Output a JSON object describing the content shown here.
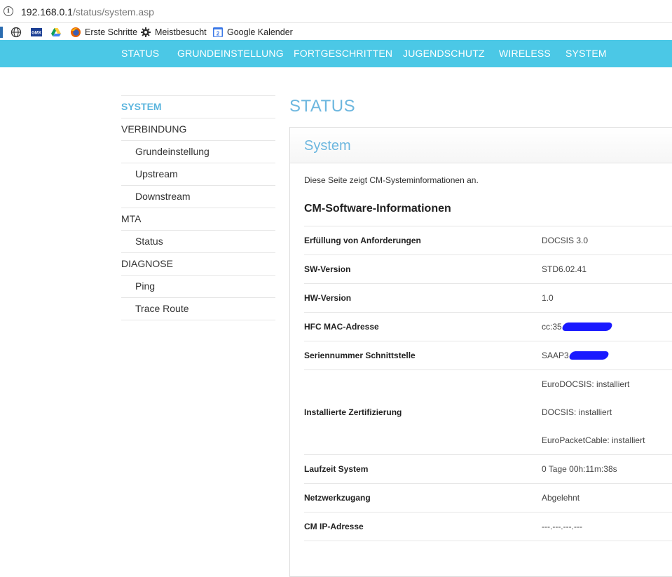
{
  "browser": {
    "url_host": "192.168.0.1",
    "url_path": "/status/system.asp",
    "bookmarks": [
      {
        "label": "",
        "icon": "globe-icon"
      },
      {
        "label": "",
        "icon": "gmx-icon"
      },
      {
        "label": "",
        "icon": "google-drive-icon"
      },
      {
        "label": "Erste Schritte",
        "icon": "firefox-icon"
      },
      {
        "label": "Meistbesucht",
        "icon": "gear-icon"
      },
      {
        "label": "Google Kalender",
        "icon": "calendar-icon",
        "icon_text": "2"
      }
    ]
  },
  "topnav": {
    "items": [
      "STATUS",
      "GRUNDEINSTELLUNG",
      "FORTGESCHRITTEN",
      "JUGENDSCHUTZ",
      "WIRELESS",
      "SYSTEM"
    ],
    "color": "#4bc8e6"
  },
  "sidebar": {
    "items": [
      {
        "label": "SYSTEM",
        "active": true
      },
      {
        "label": "VERBINDUNG"
      },
      {
        "label": "Grundeinstellung"
      },
      {
        "label": "Upstream"
      },
      {
        "label": "Downstream"
      },
      {
        "label": "MTA"
      },
      {
        "label": "Status"
      },
      {
        "label": "DIAGNOSE"
      },
      {
        "label": "Ping"
      },
      {
        "label": "Trace Route"
      }
    ]
  },
  "main": {
    "page_title": "STATUS",
    "panel_title": "System",
    "description": "Diese Seite zeigt CM-Systeminformationen an.",
    "section_title": "CM-Software-Informationen",
    "rows": [
      {
        "key": "Erfüllung von Anforderungen",
        "value": "DOCSIS 3.0"
      },
      {
        "key": "SW-Version",
        "value": "STD6.02.41"
      },
      {
        "key": "HW-Version",
        "value": "1.0"
      },
      {
        "key": "HFC MAC-Adresse",
        "value": "cc:35"
      },
      {
        "key": "Seriennummer Schnittstelle",
        "value": "SAAP3"
      },
      {
        "key": "Installierte Zertifizierung",
        "values": [
          "EuroDOCSIS: installiert",
          "DOCSIS: installiert",
          "EuroPacketCable: installiert"
        ]
      },
      {
        "key": "Laufzeit System",
        "value": "0 Tage 00h:11m:38s"
      },
      {
        "key": "Netzwerkzugang",
        "value": "Abgelehnt"
      },
      {
        "key": "CM IP-Adresse",
        "value": "---.---.---.---"
      }
    ],
    "accent_color": "#6db7df"
  }
}
